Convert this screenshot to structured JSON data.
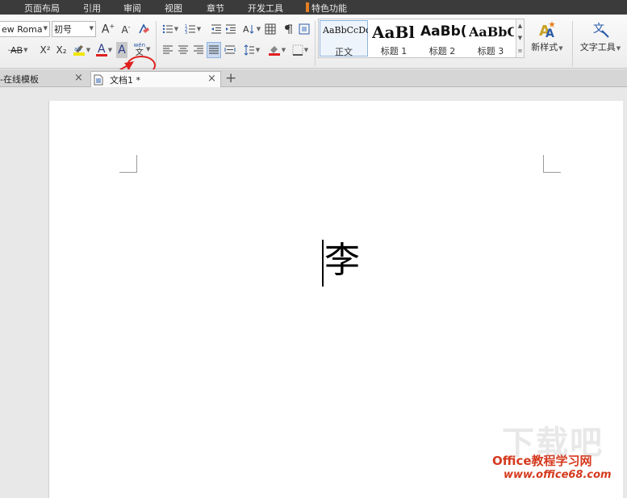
{
  "menu": {
    "items": [
      "页面布局",
      "引用",
      "审阅",
      "视图",
      "章节",
      "开发工具",
      "特色功能"
    ],
    "feature_mark_color": "#e67e22"
  },
  "ribbon": {
    "font_name": "ew Roma",
    "font_size": "初号",
    "icons": {
      "grow_font": "font-grow-icon",
      "shrink_font": "font-shrink-icon",
      "clear_format": "clear-format-icon",
      "strikethrough": "strikethrough-icon",
      "superscript": "superscript-icon",
      "subscript": "subscript-icon",
      "highlight": "highlight-icon",
      "font_color": "font-color-icon",
      "char_shading": "character-shading-icon",
      "phonetic_guide": "phonetic-guide-icon",
      "bullets": "bullets-icon",
      "numbering": "numbering-icon",
      "outdent": "decrease-indent-icon",
      "indent": "increase-indent-icon",
      "text_direction": "text-direction-icon",
      "table": "table-icon",
      "paragraph_mark": "paragraph-mark-icon",
      "frame": "frame-icon",
      "align_left": "align-left-icon",
      "align_center": "align-center-icon",
      "align_right": "align-right-icon",
      "justify": "justify-icon",
      "distribute": "distribute-icon",
      "line_spacing": "line-spacing-icon",
      "shading": "shading-icon",
      "borders": "borders-icon"
    },
    "strike_label": "AB",
    "superscript_label": "X²",
    "subscript_label": "X₂",
    "font_color_label": "A",
    "char_shading_label": "A",
    "grow_label": "A",
    "shrink_label": "A",
    "phonetic_top": "wén",
    "phonetic_bottom": "文",
    "styles": [
      {
        "preview": "AaBbCcDd",
        "label": "正文"
      },
      {
        "preview": "AaBl",
        "label": "标题 1"
      },
      {
        "preview": "AaBb(",
        "label": "标题 2"
      },
      {
        "preview": "AaBbC",
        "label": "标题 3"
      }
    ],
    "new_style_label": "新样式",
    "text_tools_label": "文字工具"
  },
  "tabs": [
    {
      "label": "-在线模板",
      "active": false
    },
    {
      "label": "文档1 *",
      "active": true
    }
  ],
  "document": {
    "content": "李"
  },
  "annotation": {
    "color": "#e02020"
  },
  "watermark": {
    "logo": "下载吧",
    "brand": "Office教程学习网",
    "url": "www.office68.com",
    "color": "#d53a1f"
  }
}
